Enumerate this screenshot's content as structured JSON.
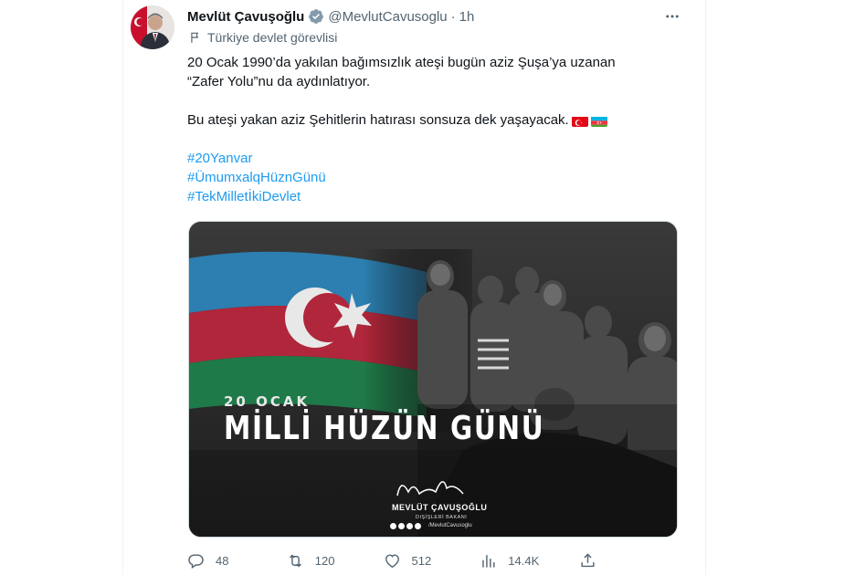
{
  "tweet": {
    "author_name": "Mevlüt Çavuşoğlu",
    "handle": "@MevlutCavusoglu",
    "separator": "·",
    "time": "1h",
    "account_label": "Türkiye devlet görevlisi",
    "text_line_1": "20 Ocak 1990’da yakılan bağımsızlık ateşi bugün aziz Şuşa’ya uzanan",
    "text_line_2": "“Zafer Yolu”nu da aydınlatıyor.",
    "text_line_3": "Bu ateşi yakan aziz Şehitlerin hatırası sonsuza dek yaşayacak.",
    "hashtags": [
      "#20Yanvar",
      "#ÜmumxalqHüznGünü",
      "#TekMilletİkiDevlet"
    ]
  },
  "media": {
    "title_small": "20 OCAK",
    "title_big": "MİLLİ HÜZÜN GÜNÜ",
    "signature_name": "MEVLÜT ÇAVUŞOĞLU",
    "signature_role": "DIŞİŞLERİ BAKANI",
    "signature_handle": "/MevlutCavusoglu"
  },
  "actions": {
    "replies": "48",
    "retweets": "120",
    "likes": "512",
    "views": "14.4K"
  },
  "icons": {
    "verified": "verified-badge-icon",
    "more": "more-dots-icon",
    "label": "flag-icon",
    "reply": "reply-icon",
    "retweet": "retweet-icon",
    "like": "heart-icon",
    "views": "analytics-icon",
    "share": "share-icon"
  },
  "colors": {
    "accent": "#1d9bf0",
    "muted": "#536471",
    "text": "#0f1419"
  }
}
